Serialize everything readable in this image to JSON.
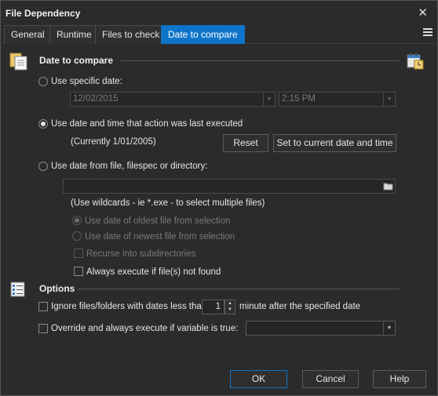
{
  "window": {
    "title": "File Dependency",
    "close_glyph": "✕"
  },
  "tabs": [
    "General",
    "Runtime",
    "Files to check",
    "Date to compare"
  ],
  "active_tab": "Date to compare",
  "date_section": {
    "title": "Date to compare",
    "specific_date": {
      "label": "Use specific date:",
      "date_value": "12/02/2015",
      "time_value": "2:15 PM"
    },
    "last_executed": {
      "label": "Use date and time that action was last executed",
      "current": "(Currently 1/01/2005)",
      "reset_label": "Reset",
      "set_current_label": "Set to current date and time"
    },
    "from_file": {
      "label": "Use date from file, filespec or directory:",
      "path_value": "",
      "hint": "(Use wildcards - ie *.exe - to select multiple files)",
      "oldest_label": "Use date of oldest file from selection",
      "newest_label": "Use date of newest file from selection",
      "recurse_label": "Recurse into subdirectories",
      "always_execute_label": "Always execute if file(s) not found"
    }
  },
  "options_section": {
    "title": "Options",
    "ignore_label": "Ignore files/folders with dates less than",
    "ignore_value": "1",
    "ignore_suffix": "minute after the specified date",
    "override_label": "Override and always execute if variable is true:",
    "override_value": ""
  },
  "buttons": {
    "ok": "OK",
    "cancel": "Cancel",
    "help": "Help"
  },
  "colors": {
    "accent": "#0e74c9",
    "background": "#2b2b2b"
  }
}
